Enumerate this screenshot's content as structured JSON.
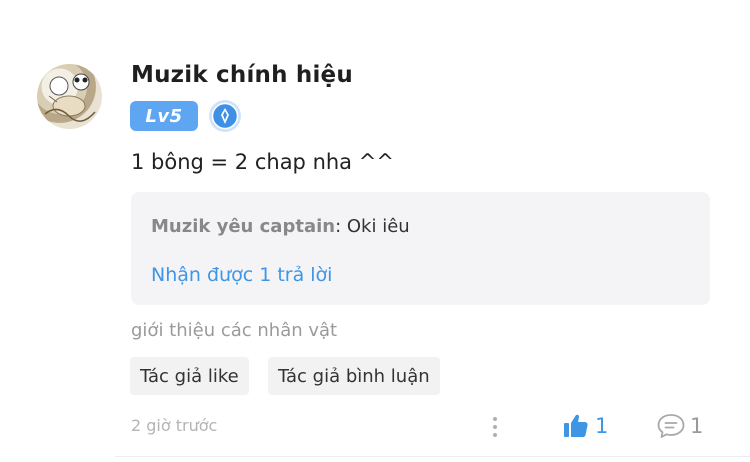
{
  "comment": {
    "username": "Muzik chính hiệu",
    "level_badge": "Lv5",
    "text": "1 bông = 2 chap nha ^^",
    "reply_preview": {
      "author": "Muzik yêu captain",
      "separator": ": ",
      "text": "Oki iêu",
      "reply_count_text": "Nhận được 1 trả lời"
    },
    "chapter": "giới thiệu các nhân vật",
    "tags": [
      "Tác giả like",
      "Tác giả bình luận"
    ],
    "timestamp": "2 giờ trước",
    "like_count": "1",
    "reply_count": "1"
  },
  "colors": {
    "accent_blue": "#3e95e6",
    "badge_blue": "#5ea5f2",
    "reply_bg": "#f4f4f6",
    "tag_bg": "#f2f2f2"
  },
  "icons": {
    "avatar": "avatar-image",
    "medal": "medal-icon",
    "more": "more-vertical-icon",
    "like": "thumbs-up-icon",
    "reply": "comment-bubble-icon"
  }
}
